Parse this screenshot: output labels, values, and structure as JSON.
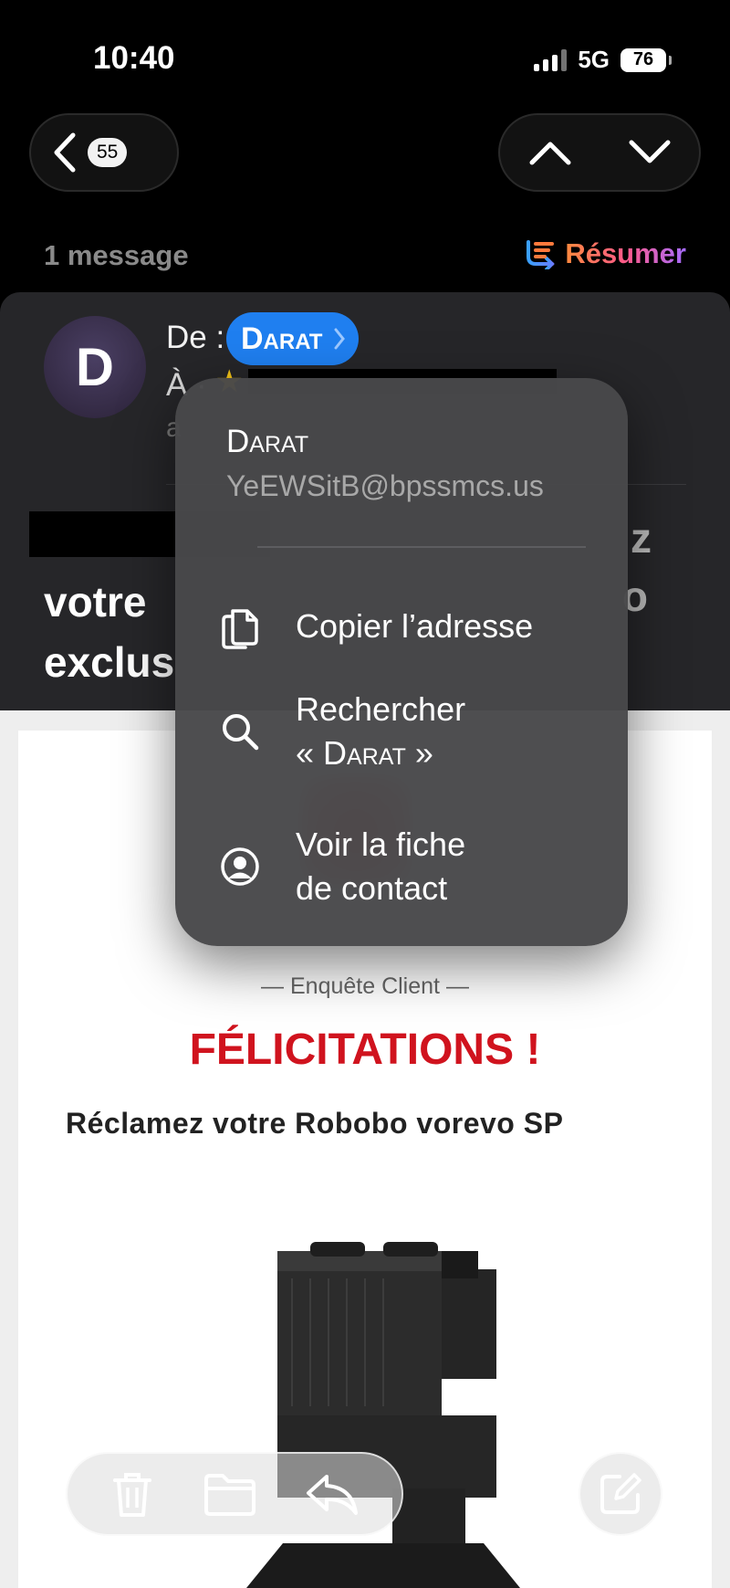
{
  "status_bar": {
    "time": "10:40",
    "network": "5G",
    "battery": "76"
  },
  "nav": {
    "back_count": "55"
  },
  "thread": {
    "message_count": "1 message",
    "summarize_label": "Résumer"
  },
  "header": {
    "avatar_initial": "D",
    "from_label": "De :",
    "sender_name": "Darat",
    "to_label": "À ·",
    "date_fragment": "a",
    "subject_lines": [
      "votre",
      "exclus"
    ],
    "subject_fragments": [
      "z",
      "o"
    ]
  },
  "context_menu": {
    "contact_name": "Darat",
    "contact_email": "YeEWSitB@bpssmcs.us",
    "items": [
      {
        "label": "Copier l’adresse",
        "icon": "copy-icon"
      },
      {
        "label_line1": "Rechercher",
        "label_line2": "« Darat »",
        "icon": "search-icon"
      },
      {
        "label_line1": "Voir la fiche",
        "label_line2": "de contact",
        "icon": "contact-icon"
      }
    ]
  },
  "email_body": {
    "kicker": "— Enquête Client —",
    "headline": "FÉLICITATIONS !",
    "subheadline": "Réclamez votre Robobo vorevo SP",
    "headline_color": "#d0131e"
  },
  "toolbar": {
    "icons": [
      "trash-icon",
      "folder-icon",
      "reply-icon",
      "compose-icon"
    ]
  },
  "colors": {
    "accent": "#1f7ff0",
    "background": "#000000"
  }
}
